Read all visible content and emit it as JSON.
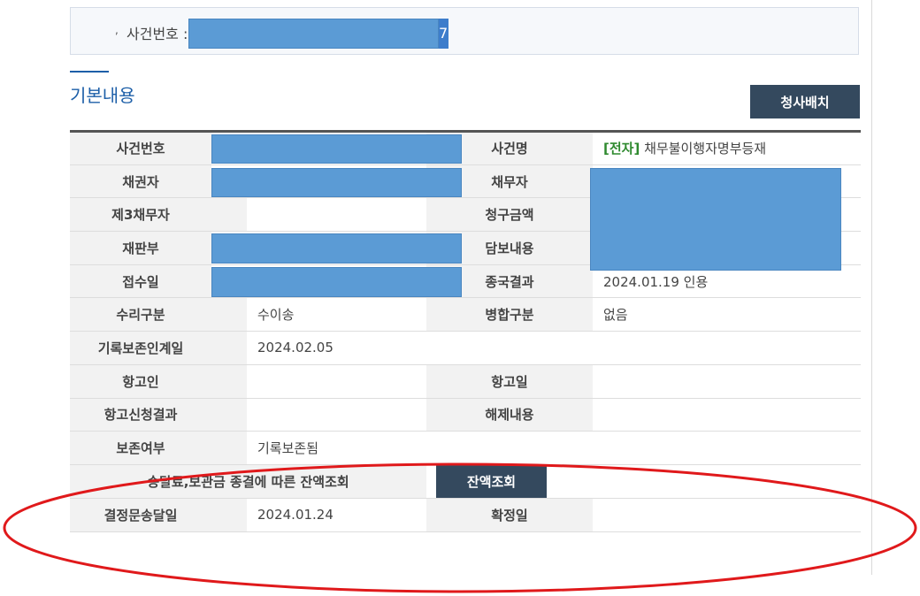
{
  "case_bar": {
    "bullet": ",",
    "label": "사건번호 :",
    "tail_char": "7"
  },
  "section": {
    "title": "기본내용",
    "request_button": "청사배치"
  },
  "table": {
    "rows": [
      {
        "l1": "사건번호",
        "v1": "",
        "l2": "사건명",
        "v2_tag": "[전자]",
        "v2": "채무불이행자명부등재"
      },
      {
        "l1": "채권자",
        "v1": "",
        "l2": "채무자",
        "v2": ""
      },
      {
        "l1": "제3채무자",
        "v1": "",
        "l2": "청구금액",
        "v2": ""
      },
      {
        "l1": "재판부",
        "v1": "",
        "l2": "담보내용",
        "v2": ""
      },
      {
        "l1": "접수일",
        "v1": "",
        "l2": "종국결과",
        "v2": "2024.01.19 인용"
      },
      {
        "l1": "수리구분",
        "v1": "수이송",
        "l2": "병합구분",
        "v2": "없음"
      },
      {
        "l1": "기록보존인계일",
        "v1": "2024.02.05"
      },
      {
        "l1": "항고인",
        "v1": "",
        "l2": "항고일",
        "v2": ""
      },
      {
        "l1": "항고신청결과",
        "v1": "",
        "l2": "해제내용",
        "v2": ""
      },
      {
        "l1": "보존여부",
        "v1": "기록보존됨"
      },
      {
        "l1": "송달료,보관금 종결에 따른 잔액조회",
        "button": "잔액조회"
      },
      {
        "l1": "결정문송달일",
        "v1": "2024.01.24",
        "l2": "확정일",
        "v2": ""
      }
    ]
  },
  "colors": {
    "accent_blue": "#1d5fa8",
    "redaction": "#5b9bd5",
    "button_dark": "#34495e",
    "highlight_oval": "#e0191b",
    "tag_green": "#2f8a2f"
  }
}
